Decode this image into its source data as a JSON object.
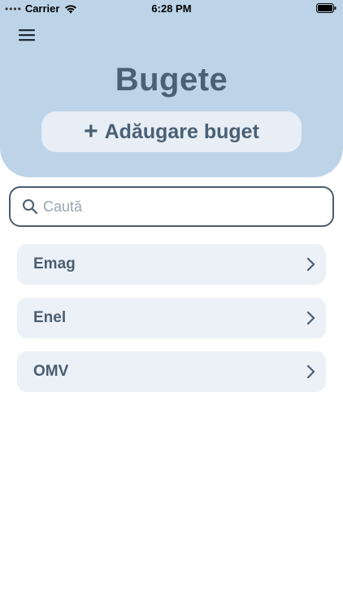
{
  "status_bar": {
    "signal_dots": "••••",
    "carrier": "Carrier",
    "time": "6:28 PM"
  },
  "header": {
    "menu_icon": "hamburger-icon",
    "title": "Bugete",
    "add_button_icon": "+",
    "add_button_label": "Adăugare buget"
  },
  "search": {
    "placeholder": "Caută",
    "value": ""
  },
  "budgets": [
    {
      "label": "Emag"
    },
    {
      "label": "Enel"
    },
    {
      "label": "OMV"
    }
  ],
  "colors": {
    "header_bg": "#bdd4e8",
    "button_bg": "#e8eef6",
    "item_bg": "#ecf1f8",
    "text": "#4a5d70"
  }
}
